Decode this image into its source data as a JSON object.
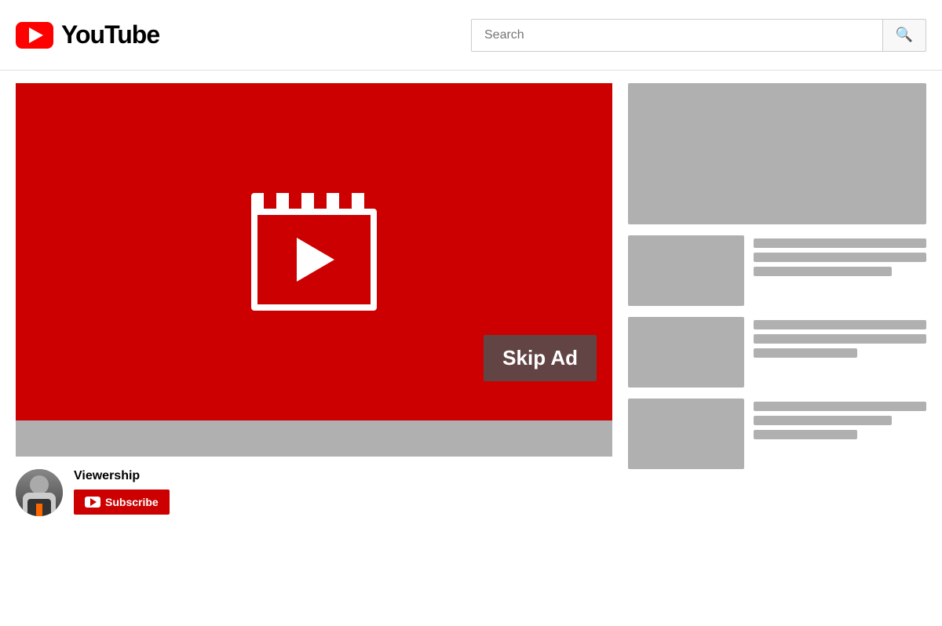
{
  "header": {
    "logo_text": "YouTube",
    "search_placeholder": "Search",
    "search_button_label": "Search"
  },
  "video": {
    "skip_ad_label": "Skip Ad",
    "channel_name": "Viewership",
    "subscribe_label": "Subscribe"
  },
  "sidebar": {
    "items": [
      {
        "id": 1
      },
      {
        "id": 2
      },
      {
        "id": 3
      }
    ]
  }
}
